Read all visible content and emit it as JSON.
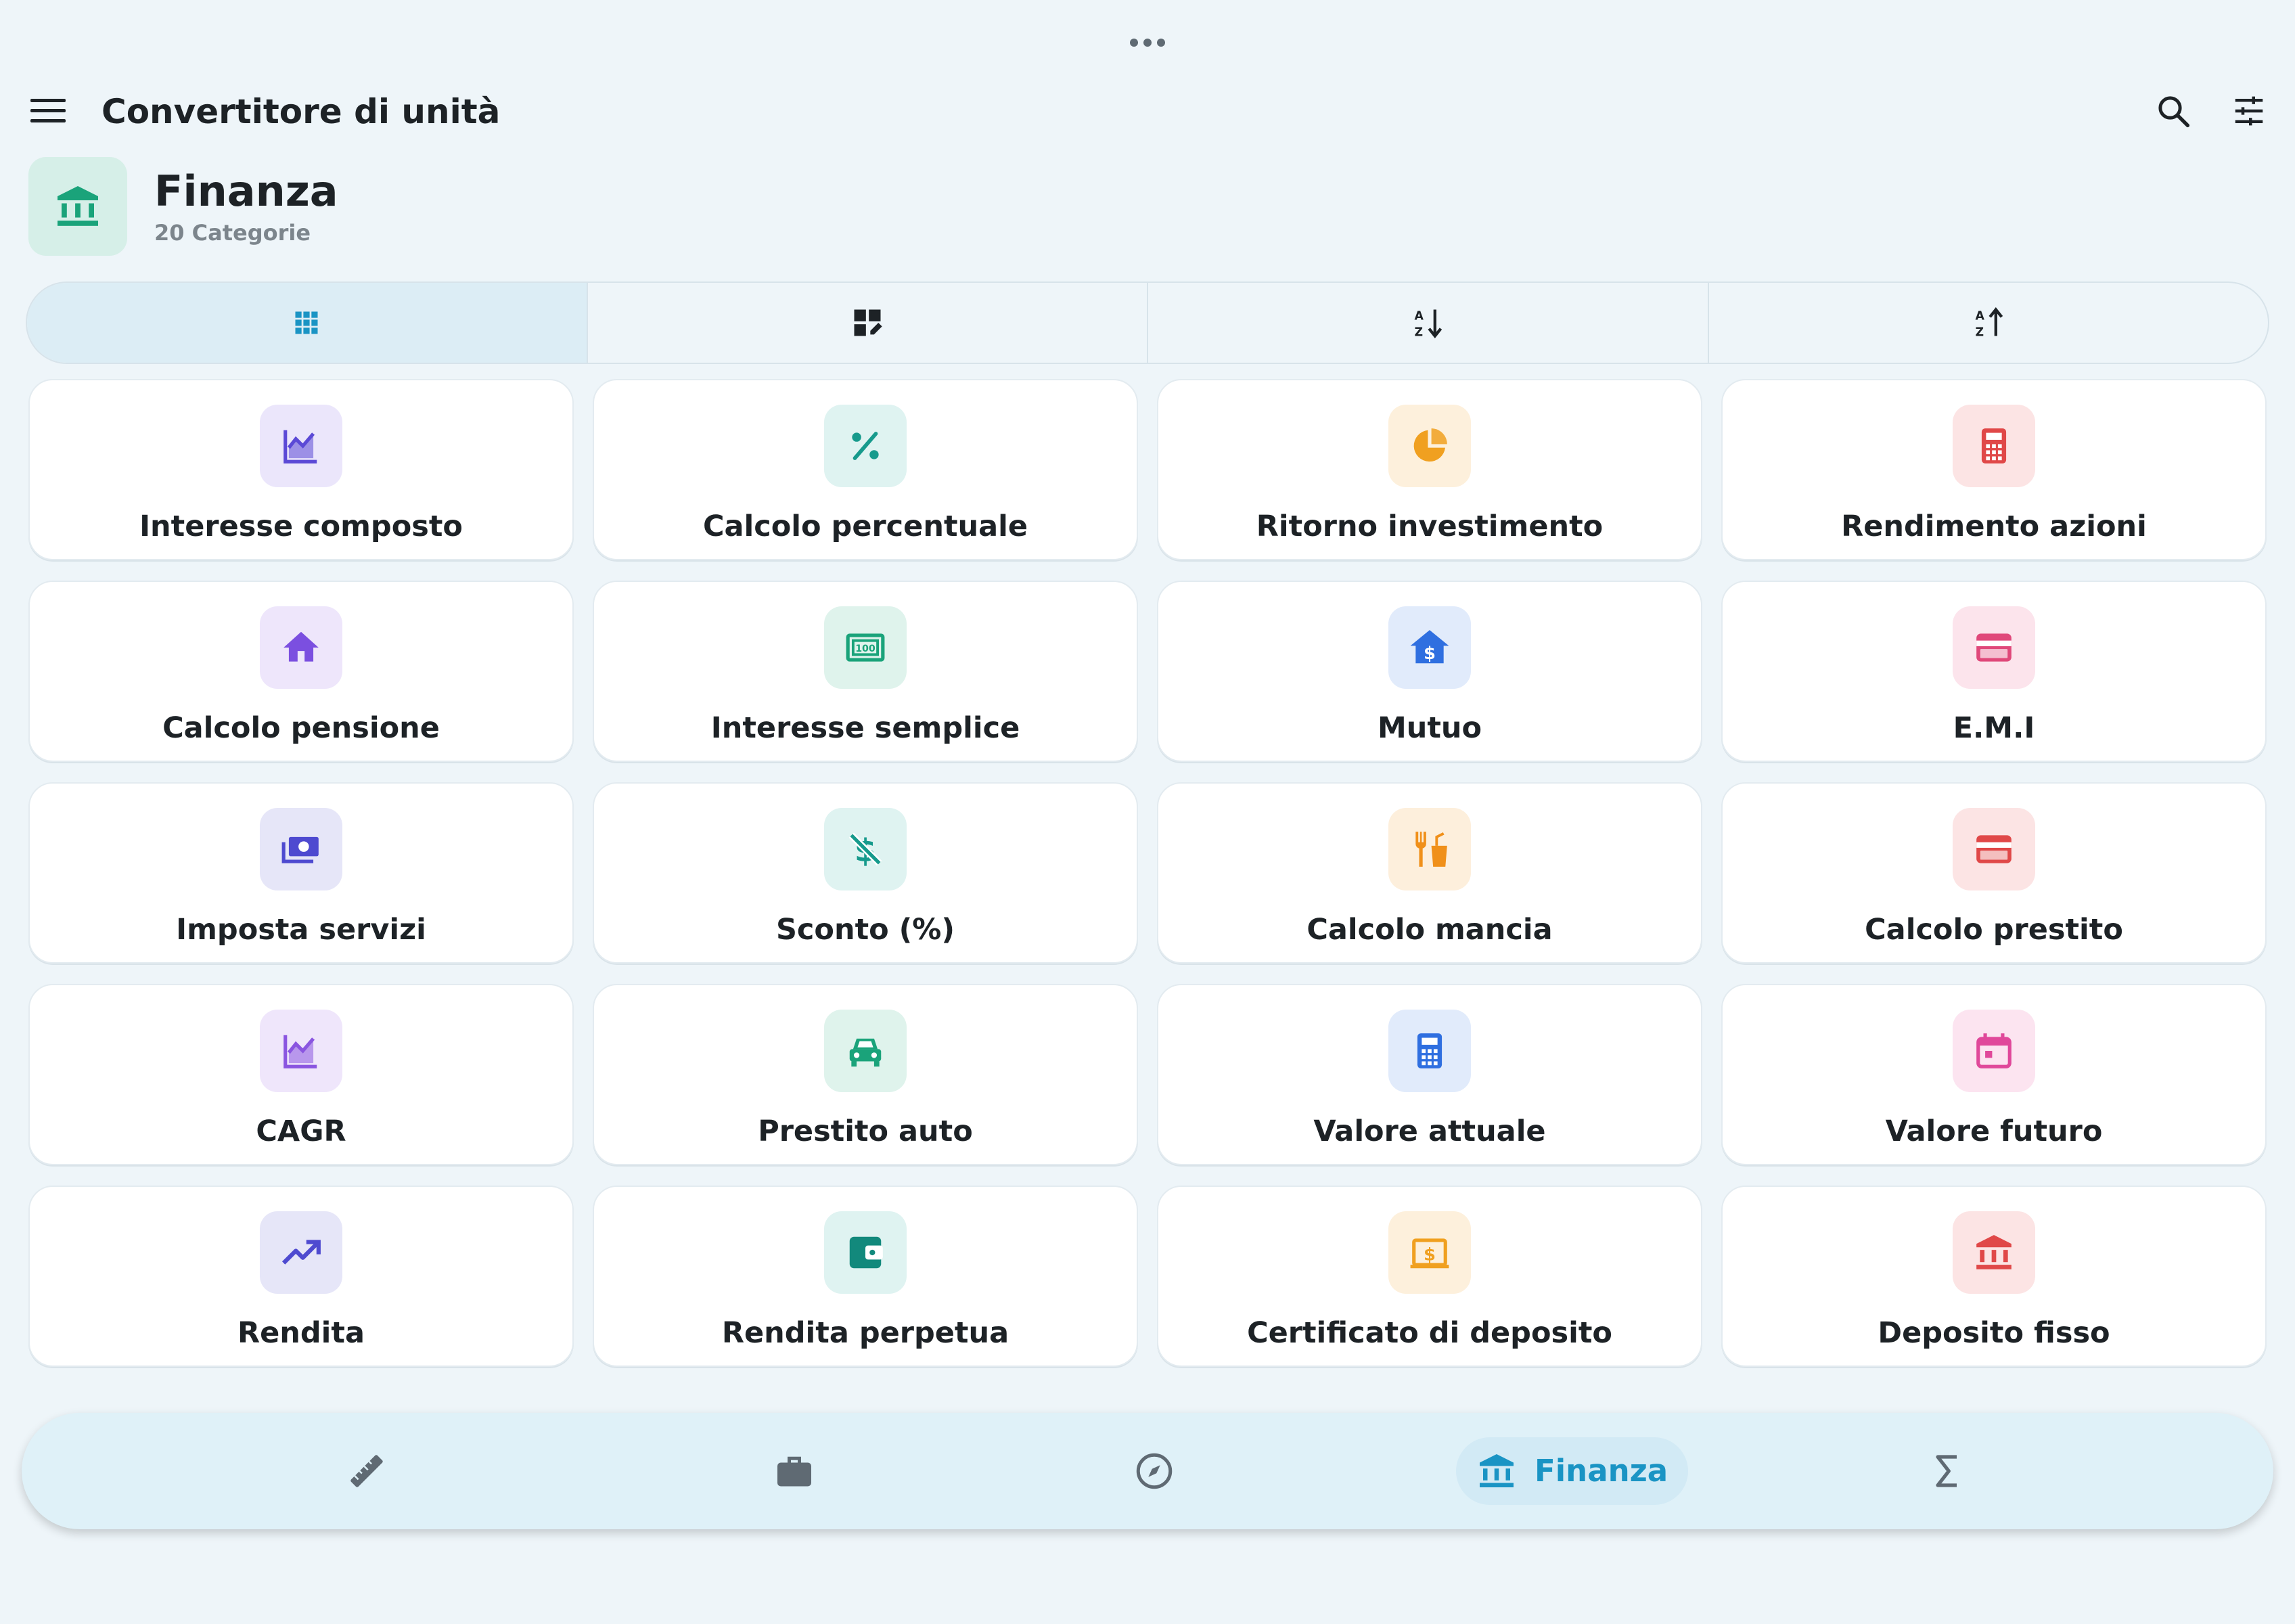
{
  "app": {
    "title": "Convertitore di unità",
    "handle_icon": "more-horiz-icon"
  },
  "header_icons": {
    "menu": "menu-icon",
    "search": "search-icon",
    "filter": "tune-icon"
  },
  "category": {
    "title": "Finanza",
    "subtitle": "20 Categorie",
    "icon": "bank-icon",
    "color": "#1aa37a"
  },
  "view_modes": [
    {
      "icon": "grid-view-icon",
      "active": true
    },
    {
      "icon": "dashboard-customize-icon",
      "active": false
    },
    {
      "icon": "sort-az-down-icon",
      "active": false
    },
    {
      "icon": "sort-az-up-icon",
      "active": false
    }
  ],
  "items": [
    {
      "label": "Interesse composto",
      "icon": "area-chart-icon",
      "color": "#5b49d6",
      "bg": "#ebe6fb"
    },
    {
      "label": "Calcolo percentuale",
      "icon": "percent-icon",
      "color": "#169a8c",
      "bg": "#dff3f1"
    },
    {
      "label": "Ritorno investimento",
      "icon": "pie-chart-icon",
      "color": "#f0a020",
      "bg": "#fdf0dc"
    },
    {
      "label": "Rendimento azioni",
      "icon": "calculator-icon",
      "color": "#e04848",
      "bg": "#fce4e4"
    },
    {
      "label": "Calcolo pensione",
      "icon": "home-icon",
      "color": "#7b4fe0",
      "bg": "#eee6fb"
    },
    {
      "label": "Interesse semplice",
      "icon": "money-icon",
      "color": "#1aa37a",
      "bg": "#dff3ec"
    },
    {
      "label": "Mutuo",
      "icon": "home-dollar-icon",
      "color": "#2f6fe0",
      "bg": "#e1ebfb"
    },
    {
      "label": "E.M.I",
      "icon": "credit-card-icon",
      "color": "#e0487a",
      "bg": "#fce4ec"
    },
    {
      "label": "Imposta servizi",
      "icon": "payments-icon",
      "color": "#4e4ad0",
      "bg": "#e6e6f8"
    },
    {
      "label": "Sconto (%)",
      "icon": "money-off-icon",
      "color": "#169a8c",
      "bg": "#dff3f1"
    },
    {
      "label": "Calcolo mancia",
      "icon": "restaurant-icon",
      "color": "#f0901a",
      "bg": "#fdefdc"
    },
    {
      "label": "Calcolo prestito",
      "icon": "credit-card-icon",
      "color": "#e04848",
      "bg": "#fce4e4"
    },
    {
      "label": "CAGR",
      "icon": "area-chart-icon",
      "color": "#8a55e0",
      "bg": "#efe6fb"
    },
    {
      "label": "Prestito auto",
      "icon": "car-icon",
      "color": "#1aa37a",
      "bg": "#dff3ec"
    },
    {
      "label": "Valore attuale",
      "icon": "calculator-icon",
      "color": "#2f6fe0",
      "bg": "#e1ebfb"
    },
    {
      "label": "Valore futuro",
      "icon": "calendar-icon",
      "color": "#e0489a",
      "bg": "#fce4f0"
    },
    {
      "label": "Rendita",
      "icon": "trending-up-icon",
      "color": "#4e4ad0",
      "bg": "#e6e6f8"
    },
    {
      "label": "Rendita perpetua",
      "icon": "wallet-icon",
      "color": "#12897c",
      "bg": "#dff3f1"
    },
    {
      "label": "Certificato di deposito",
      "icon": "dollar-box-icon",
      "color": "#f0a020",
      "bg": "#fdf0dc"
    },
    {
      "label": "Deposito fisso",
      "icon": "bank-icon",
      "color": "#e04848",
      "bg": "#fce4e4"
    }
  ],
  "bottom_nav": [
    {
      "icon": "ruler-icon",
      "label": "",
      "active": false
    },
    {
      "icon": "briefcase-icon",
      "label": "",
      "active": false
    },
    {
      "icon": "compass-icon",
      "label": "",
      "active": false
    },
    {
      "icon": "bank-icon",
      "label": "Finanza",
      "active": true
    },
    {
      "icon": "sigma-icon",
      "label": "",
      "active": false
    }
  ],
  "colors": {
    "background": "#eef5f9",
    "accent": "#1a94c4",
    "nav_background": "#dff1f8",
    "segment_active": "#dcedf5",
    "icon_muted": "#5f6a73"
  }
}
